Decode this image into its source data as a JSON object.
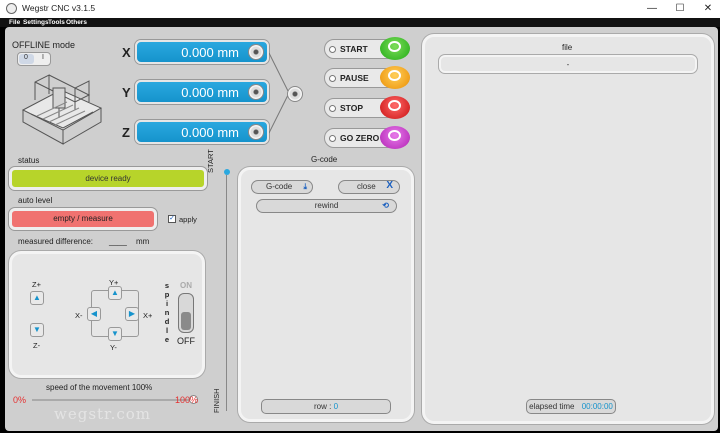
{
  "window": {
    "title": "Wegstr CNC  v3.1.5",
    "minimize": "—",
    "maximize": "☐",
    "close": "✕"
  },
  "menu": [
    {
      "label": "File"
    },
    {
      "label": "Settings"
    },
    {
      "label": "Tools"
    },
    {
      "label": "Others"
    }
  ],
  "mode": {
    "label": "OFFLINE mode",
    "switch_left": "0",
    "switch_right": "I"
  },
  "axes": [
    {
      "label": "X",
      "value": "0.000 mm"
    },
    {
      "label": "Y",
      "value": "0.000 mm"
    },
    {
      "label": "Z",
      "value": "0.000 mm"
    }
  ],
  "controls": [
    {
      "label": "START",
      "color": "#3cba2a"
    },
    {
      "label": "PAUSE",
      "color": "#f1a21d"
    },
    {
      "label": "STOP",
      "color": "#d92a2a"
    },
    {
      "label": "GO ZERO",
      "color": "#c13cc4"
    }
  ],
  "status": {
    "label": "status",
    "value": "device ready",
    "color": "#b7d42a"
  },
  "autolevel": {
    "label": "auto level",
    "button": "empty / measure",
    "apply": "apply",
    "apply_checked": true,
    "color": "#f07270"
  },
  "measured": {
    "label": "measured difference:",
    "value": "____",
    "unit": "mm"
  },
  "jog": {
    "zplus": "Z+",
    "zminus": "Z-",
    "yplus": "Y+",
    "yminus": "Y-",
    "xminus": "X-",
    "xplus": "X+"
  },
  "spindle": {
    "label_letters": [
      "s",
      "p",
      "i",
      "n",
      "d",
      "l",
      "e"
    ],
    "state": "OFF",
    "on_glyph": "ON"
  },
  "speed": {
    "label": "speed of the movement 100%",
    "min": "0%",
    "max": "100%",
    "level": 1.0,
    "watermark": "wegstr.com"
  },
  "progress": {
    "start": "START",
    "finish": "FINISH"
  },
  "gcode": {
    "title": "G-code",
    "load": "G-code",
    "close": "close",
    "rewind": "rewind",
    "row_label": "row :",
    "row_value": "0"
  },
  "file": {
    "title": "file",
    "name": "-",
    "elapsed_label": "elapsed time",
    "elapsed_value": "00:00:00"
  }
}
